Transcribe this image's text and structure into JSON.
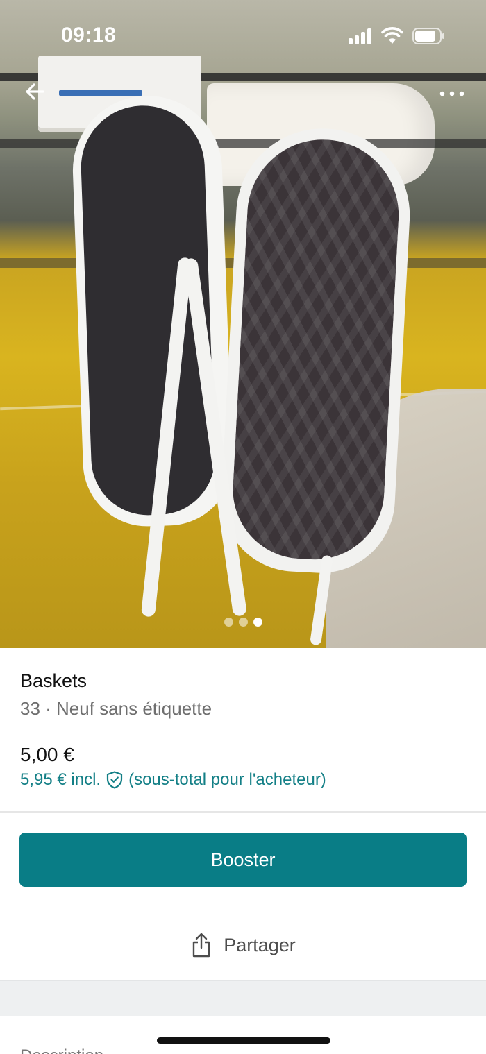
{
  "status_bar": {
    "time": "09:18"
  },
  "gallery": {
    "image_count": 3,
    "active_index": 2
  },
  "listing": {
    "title": "Baskets",
    "subtitle": "33 · Neuf sans étiquette",
    "price": "5,00 €",
    "price_incl": "5,95 € incl.",
    "price_incl_note": "(sous-total pour l'acheteur)"
  },
  "actions": {
    "booster_label": "Booster",
    "share_label": "Partager"
  },
  "description": {
    "label": "Description"
  },
  "icons": {
    "back": "arrow-left-icon",
    "more": "more-horizontal-icon",
    "shield": "shield-check-icon",
    "share": "share-icon"
  },
  "colors": {
    "accent": "#097d86",
    "accent_text": "#137f86",
    "secondary_text": "#6f6f6f"
  }
}
